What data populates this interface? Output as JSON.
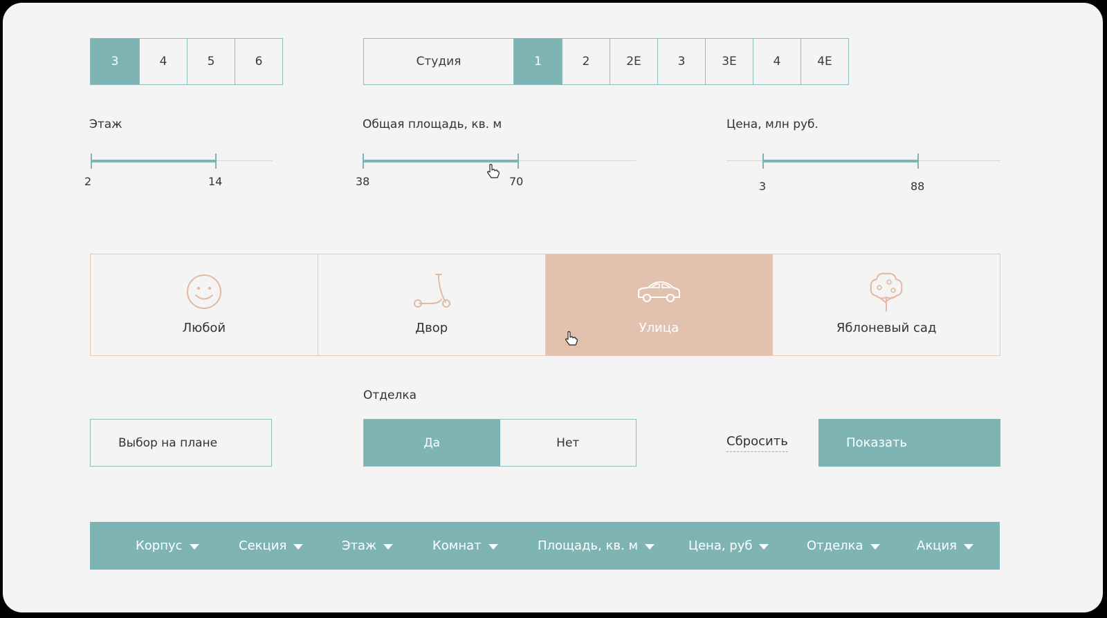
{
  "building_tabs": [
    {
      "label": "3",
      "active": true
    },
    {
      "label": "4",
      "active": false
    },
    {
      "label": "5",
      "active": false
    },
    {
      "label": "6",
      "active": false
    }
  ],
  "room_tabs": [
    {
      "label": "Студия",
      "active": false
    },
    {
      "label": "1",
      "active": true
    },
    {
      "label": "2",
      "active": false
    },
    {
      "label": "2Е",
      "active": false
    },
    {
      "label": "3",
      "active": false
    },
    {
      "label": "3Е",
      "active": false
    },
    {
      "label": "4",
      "active": false
    },
    {
      "label": "4Е",
      "active": false
    }
  ],
  "floor": {
    "label": "Этаж",
    "min": "2",
    "max": "14"
  },
  "area": {
    "label": "Общая площадь, кв. м",
    "min": "38",
    "max": "70"
  },
  "price": {
    "label": "Цена, млн руб.",
    "min": "3",
    "max": "88"
  },
  "yards": [
    {
      "label": "Любой",
      "icon": "smiley-icon",
      "active": false
    },
    {
      "label": "Двор",
      "icon": "scooter-icon",
      "active": false
    },
    {
      "label": "Улица",
      "icon": "car-icon",
      "active": true
    },
    {
      "label": "Яблоневый сад",
      "icon": "apple-tree-icon",
      "active": false
    }
  ],
  "plan_button": "Выбор на плане",
  "finishing": {
    "label": "Отделка",
    "yes": "Да",
    "no": "Нет",
    "selected": "Да"
  },
  "reset": "Сбросить",
  "show": "Показать",
  "table_columns": [
    "Корпус",
    "Секция",
    "Этаж",
    "Комнат",
    "Площадь, кв. м",
    "Цена, руб",
    "Отделка",
    "Акция"
  ],
  "colors": {
    "accent": "#7fb4b4",
    "peach": "#e2c1ae",
    "background": "#f4f4f4"
  }
}
